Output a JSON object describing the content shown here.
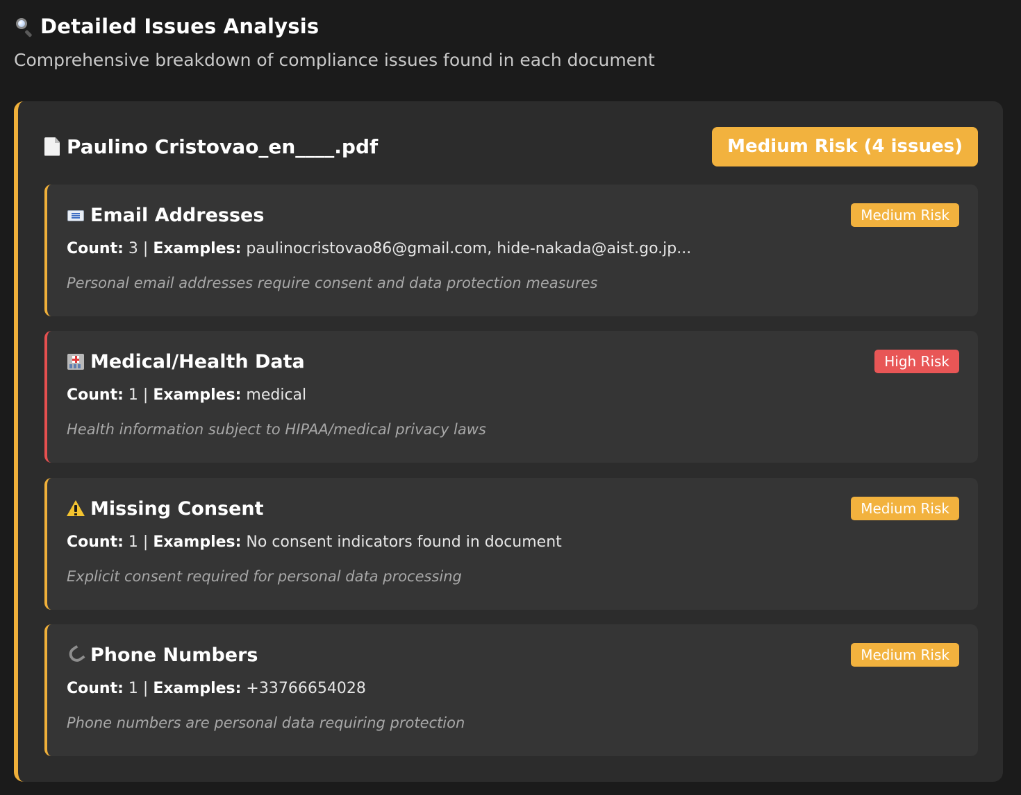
{
  "section": {
    "icon": "magnifier-icon",
    "title": "Detailed Issues Analysis",
    "subtitle": "Comprehensive breakdown of compliance issues found in each document"
  },
  "document": {
    "icon": "document-icon",
    "name": "Paulino Cristovao_en____.pdf",
    "badge": "Medium Risk (4 issues)",
    "accent_color": "#f0b03a",
    "issues": [
      {
        "icon": "email-icon",
        "title": "Email Addresses",
        "risk": "Medium Risk",
        "count_label": "Count:",
        "count": "3",
        "examples_label": "Examples:",
        "examples": "paulinocristovao86@gmail.com, hide-nakada@aist.go.jp...",
        "note": "Personal email addresses require consent and data protection measures"
      },
      {
        "icon": "hospital-icon",
        "title": "Medical/Health Data",
        "risk": "High Risk",
        "count_label": "Count:",
        "count": "1",
        "examples_label": "Examples:",
        "examples": "medical",
        "note": "Health information subject to HIPAA/medical privacy laws"
      },
      {
        "icon": "warning-icon",
        "title": "Missing Consent",
        "risk": "Medium Risk",
        "count_label": "Count:",
        "count": "1",
        "examples_label": "Examples:",
        "examples": "No consent indicators found in document",
        "note": "Explicit consent required for personal data processing"
      },
      {
        "icon": "phone-icon",
        "title": "Phone Numbers",
        "risk": "Medium Risk",
        "count_label": "Count:",
        "count": "1",
        "examples_label": "Examples:",
        "examples": "+33766654028",
        "note": "Phone numbers are personal data requiring protection"
      }
    ]
  },
  "colors": {
    "background": "#1b1b1b",
    "card": "#2c2c2c",
    "issue_card": "#353535",
    "medium_risk": "#f2b23e",
    "high_risk": "#e85656"
  }
}
